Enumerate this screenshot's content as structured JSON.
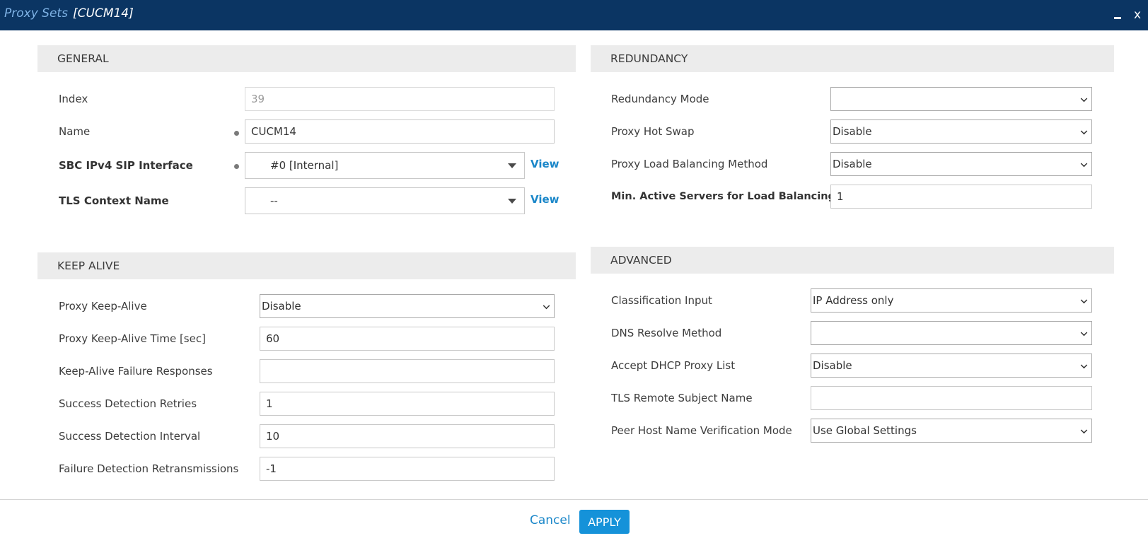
{
  "window": {
    "title": "Proxy Sets",
    "subtitle": "[CUCM14]",
    "minimize_icon": "minimize-icon",
    "close_label": "x"
  },
  "general": {
    "header": "GENERAL",
    "index": {
      "label": "Index",
      "value": "39"
    },
    "name": {
      "label": "Name",
      "value": "CUCM14"
    },
    "sip_interface": {
      "label": "SBC IPv4 SIP Interface",
      "value": "#0 [Internal]",
      "view": "View"
    },
    "tls_context": {
      "label": "TLS Context Name",
      "value": "--",
      "view": "View"
    }
  },
  "keep_alive": {
    "header": "KEEP ALIVE",
    "proxy_keep_alive": {
      "label": "Proxy Keep-Alive",
      "value": "Disable"
    },
    "keep_alive_time": {
      "label": "Proxy Keep-Alive Time [sec]",
      "value": "60"
    },
    "failure_responses": {
      "label": "Keep-Alive Failure Responses",
      "value": ""
    },
    "success_retries": {
      "label": "Success Detection Retries",
      "value": "1"
    },
    "success_interval": {
      "label": "Success Detection Interval",
      "value": "10"
    },
    "failure_retransmissions": {
      "label": "Failure Detection Retransmissions",
      "value": "-1"
    }
  },
  "redundancy": {
    "header": "REDUNDANCY",
    "mode": {
      "label": "Redundancy Mode",
      "value": ""
    },
    "hot_swap": {
      "label": "Proxy Hot Swap",
      "value": "Disable"
    },
    "load_balancing": {
      "label": "Proxy Load Balancing Method",
      "value": "Disable"
    },
    "min_active": {
      "label": "Min. Active Servers for Load Balancing",
      "value": "1"
    }
  },
  "advanced": {
    "header": "ADVANCED",
    "classification": {
      "label": "Classification Input",
      "value": "IP Address only"
    },
    "dns_method": {
      "label": "DNS Resolve Method",
      "value": ""
    },
    "dhcp_list": {
      "label": "Accept DHCP Proxy List",
      "value": "Disable"
    },
    "tls_subject": {
      "label": "TLS Remote Subject Name",
      "value": ""
    },
    "peer_verification": {
      "label": "Peer Host Name Verification Mode",
      "value": "Use Global Settings"
    }
  },
  "footer": {
    "cancel": "Cancel",
    "apply": "APPLY"
  }
}
